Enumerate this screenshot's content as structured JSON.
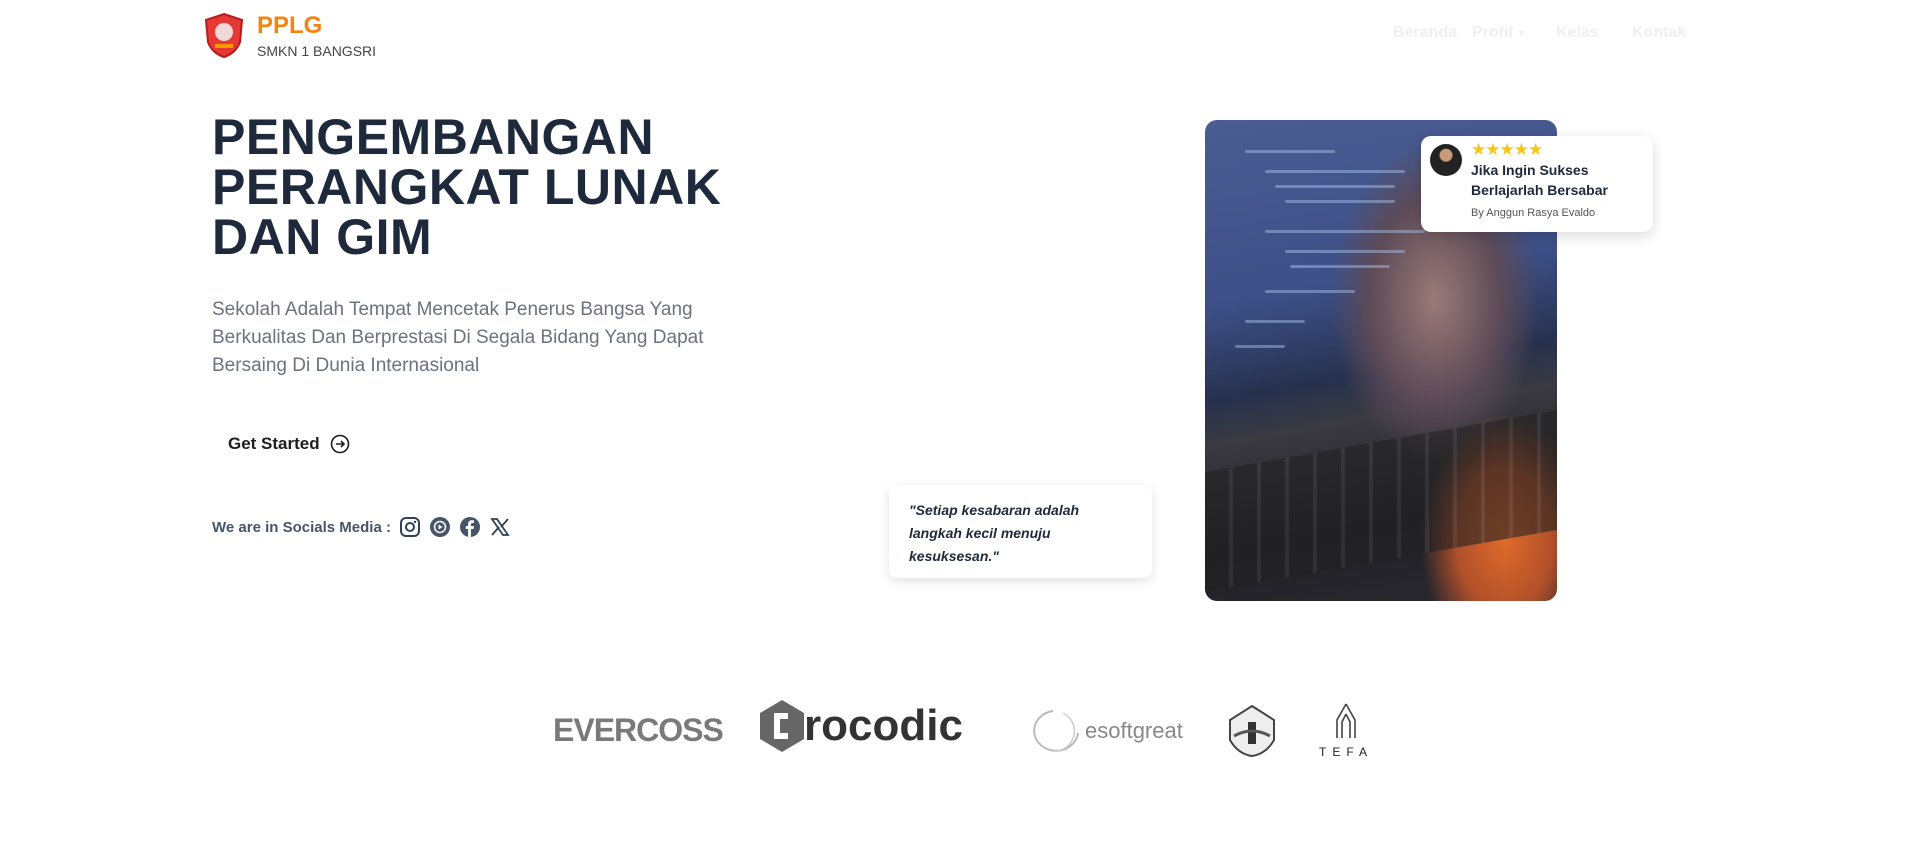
{
  "header": {
    "brand_name": "PPLG",
    "brand_subtitle": "SMKN 1 BANGSRI",
    "nav": [
      {
        "label": "Beranda"
      },
      {
        "label": "Profil",
        "dropdown": true
      },
      {
        "label": "Kelas"
      },
      {
        "label": "Kontak"
      }
    ]
  },
  "hero": {
    "title_lines": [
      "PENGEMBANGAN",
      "PERANGKAT LUNAK",
      "DAN GIM"
    ],
    "subtitle": "Sekolah Adalah Tempat Mencetak Penerus Bangsa Yang Berkualitas Dan Berprestasi Di Segala Bidang Yang Dapat Bersaing Di Dunia Internasional",
    "cta_label": "Get Started",
    "socials_label": "We are in Socials Media :",
    "socials": [
      "instagram-icon",
      "youtube-icon",
      "facebook-icon",
      "x-icon"
    ]
  },
  "quote": "\"Setiap kesabaran adalah langkah kecil menuju kesuksesan.\"",
  "review": {
    "rating": 5,
    "stars": "★★★★★",
    "title": "Jika Ingin Sukses Berlajarlah Bersabar",
    "author": "By Anggun Rasya Evaldo"
  },
  "partners": {
    "evercoss": "EVERCOSS",
    "crocodic": "rocodic",
    "esoftgreat": "esoftgreat",
    "tefa": "TEFA"
  },
  "colors": {
    "brand": "#f7830f",
    "title": "#1e293b",
    "subtitle": "#6b7280"
  }
}
